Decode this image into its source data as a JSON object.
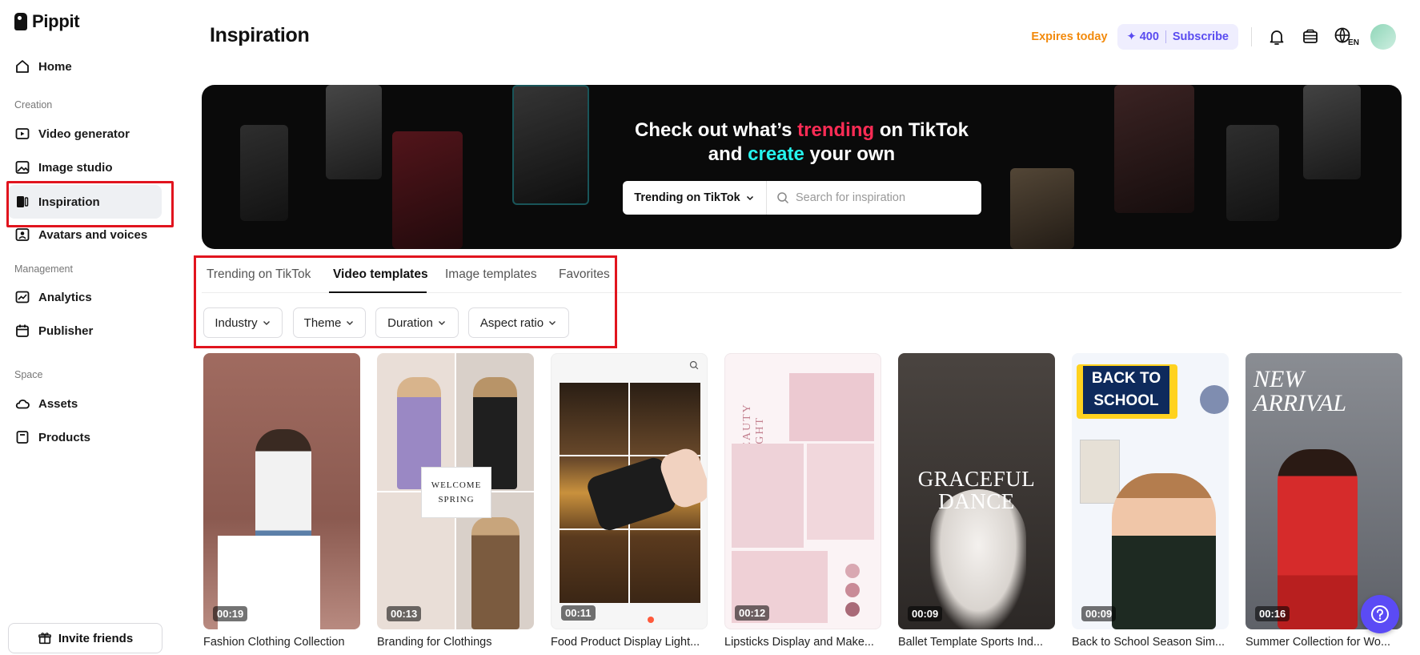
{
  "app": {
    "name": "Pippit"
  },
  "sidebar": {
    "items": [
      {
        "label": "Home"
      },
      {
        "section": "Creation"
      },
      {
        "label": "Video generator"
      },
      {
        "label": "Image studio"
      },
      {
        "label": "Inspiration"
      },
      {
        "label": "Avatars and voices"
      },
      {
        "section": "Management"
      },
      {
        "label": "Analytics"
      },
      {
        "label": "Publisher"
      },
      {
        "section": "Space"
      },
      {
        "label": "Assets"
      },
      {
        "label": "Products"
      }
    ],
    "invite_label": "Invite friends"
  },
  "header": {
    "title": "Inspiration",
    "expires": "Expires today",
    "credits": "✦ 400",
    "subscribe": "Subscribe",
    "language": "EN"
  },
  "banner": {
    "line1_a": "Check out what’s ",
    "line1_hl": "trending",
    "line1_b": " on TikTok",
    "line2_a": "and ",
    "line2_hl": "create",
    "line2_b": " your own",
    "dropdown_label": "Trending on TikTok",
    "search_placeholder": "Search for inspiration"
  },
  "tabs": [
    {
      "label": "Trending on TikTok"
    },
    {
      "label": "Video templates"
    },
    {
      "label": "Image templates"
    },
    {
      "label": "Favorites"
    }
  ],
  "filters": [
    {
      "label": "Industry"
    },
    {
      "label": "Theme"
    },
    {
      "label": "Duration"
    },
    {
      "label": "Aspect ratio"
    }
  ],
  "cards": [
    {
      "title": "Fashion Clothing Collection",
      "duration": "00:19"
    },
    {
      "title": "Branding for Clothings",
      "duration": "00:13",
      "overlay": "WELCOME SPRING"
    },
    {
      "title": "Food Product Display Light...",
      "duration": "00:11"
    },
    {
      "title": "Lipsticks Display and Make...",
      "duration": "00:12",
      "overlay": "BEAUTY LIGHT"
    },
    {
      "title": "Ballet Template Sports Ind...",
      "duration": "00:09",
      "overlay": "GRACEFUL DANCE"
    },
    {
      "title": "Back to School Season Sim...",
      "duration": "00:09",
      "overlay": "BACK TO SCHOOL"
    },
    {
      "title": "Summer Collection for Wo...",
      "duration": "00:16",
      "overlay": "NEW ARRIVAL"
    }
  ],
  "colors": {
    "accent": "#5b4bf5",
    "highlight": "#e1141e",
    "expires": "#f28a0c"
  }
}
